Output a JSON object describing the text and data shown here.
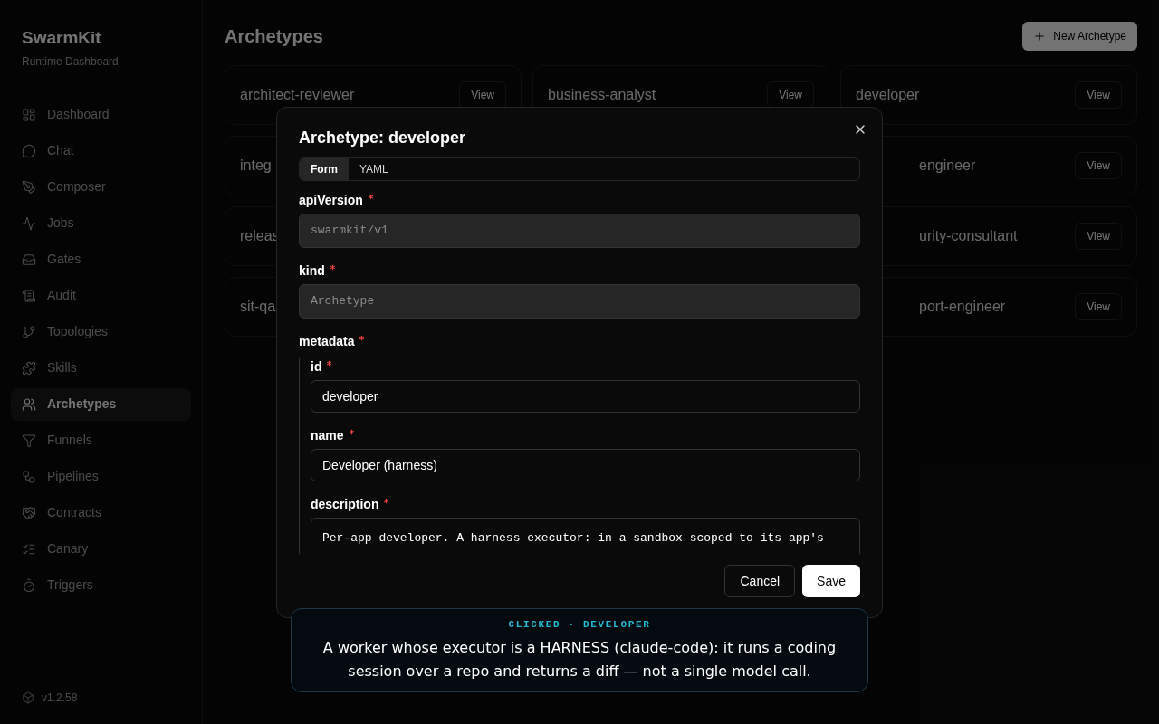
{
  "brand": {
    "title": "SwarmKit",
    "subtitle": "Runtime Dashboard"
  },
  "sidebar": {
    "items": [
      {
        "label": "Dashboard",
        "selected": false
      },
      {
        "label": "Chat",
        "selected": false
      },
      {
        "label": "Composer",
        "selected": false
      },
      {
        "label": "Jobs",
        "selected": false
      },
      {
        "label": "Gates",
        "selected": false
      },
      {
        "label": "Audit",
        "selected": false
      },
      {
        "label": "Topologies",
        "selected": false
      },
      {
        "label": "Skills",
        "selected": false
      },
      {
        "label": "Archetypes",
        "selected": true
      },
      {
        "label": "Funnels",
        "selected": false
      },
      {
        "label": "Pipelines",
        "selected": false
      },
      {
        "label": "Contracts",
        "selected": false
      },
      {
        "label": "Canary",
        "selected": false
      },
      {
        "label": "Triggers",
        "selected": false
      }
    ],
    "version": "v1.2.58"
  },
  "page": {
    "title": "Archetypes",
    "new_button": "New Archetype"
  },
  "cards": [
    {
      "name": "architect-reviewer",
      "button": "View"
    },
    {
      "name": "business-analyst",
      "button": "View"
    },
    {
      "name": "developer",
      "button": "View"
    },
    {
      "name": "integ"
    },
    {
      "name": "engineer",
      "button": "View"
    },
    {
      "name": "releas"
    },
    {
      "name": "urity-consultant",
      "button": "View"
    },
    {
      "name": "sit-qa"
    },
    {
      "name": "port-engineer",
      "button": "View"
    }
  ],
  "dialog": {
    "title": "Archetype: developer",
    "tabs": [
      {
        "label": "Form",
        "selected": true
      },
      {
        "label": "YAML",
        "selected": false
      }
    ],
    "fields": [
      {
        "label": "apiVersion",
        "required": true,
        "value": "swarmkit/v1",
        "disabled": true
      },
      {
        "label": "kind",
        "required": true,
        "value": "Archetype",
        "disabled": true
      }
    ],
    "group": {
      "label": "metadata",
      "required": true,
      "fields": [
        {
          "label": "id",
          "required": true,
          "value": "developer",
          "kind": "input"
        },
        {
          "label": "name",
          "required": true,
          "value": "Developer (harness)",
          "kind": "input"
        },
        {
          "label": "description",
          "required": true,
          "value": "Per-app developer. A harness executor: in a sandbox scoped to its app's",
          "kind": "textarea"
        }
      ]
    },
    "buttons": {
      "cancel": "Cancel",
      "save": "Save"
    }
  },
  "callout": {
    "eyebrow": "CLICKED · DEVELOPER",
    "text": "A worker whose executor is a HARNESS (claude-code): it runs a coding session over a repo and returns a diff — not a single model call."
  }
}
